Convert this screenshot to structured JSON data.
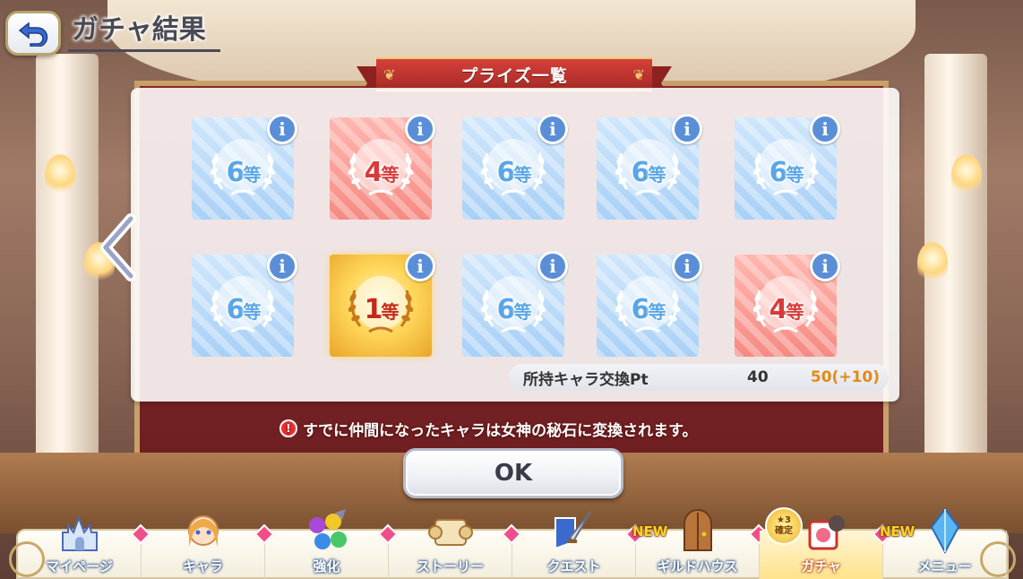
{
  "header": {
    "title": "ガチャ結果"
  },
  "banner": {
    "title": "プライズ一覧"
  },
  "prizes": [
    {
      "rank": "6",
      "unit": "等",
      "color": "blue"
    },
    {
      "rank": "4",
      "unit": "等",
      "color": "red"
    },
    {
      "rank": "6",
      "unit": "等",
      "color": "blue"
    },
    {
      "rank": "6",
      "unit": "等",
      "color": "blue"
    },
    {
      "rank": "6",
      "unit": "等",
      "color": "blue"
    },
    {
      "rank": "6",
      "unit": "等",
      "color": "blue"
    },
    {
      "rank": "1",
      "unit": "等",
      "color": "gold"
    },
    {
      "rank": "6",
      "unit": "等",
      "color": "blue"
    },
    {
      "rank": "6",
      "unit": "等",
      "color": "blue"
    },
    {
      "rank": "4",
      "unit": "等",
      "color": "red"
    }
  ],
  "info_glyph": "i",
  "points": {
    "label": "所持キャラ交換Pt",
    "current": "40",
    "after": "50(+10)"
  },
  "notice": {
    "icon": "!",
    "text": "すでに仲間になったキャラは女神の秘石に変換されます。"
  },
  "ok_button": "OK",
  "nav": {
    "items": [
      {
        "label": "マイページ",
        "icon": "castle-icon",
        "new": ""
      },
      {
        "label": "キャラ",
        "icon": "character-icon",
        "new": ""
      },
      {
        "label": "強化",
        "icon": "gems-icon",
        "new": ""
      },
      {
        "label": "ストーリー",
        "icon": "scroll-icon",
        "new": ""
      },
      {
        "label": "クエスト",
        "icon": "sword-shield-icon",
        "new": ""
      },
      {
        "label": "ギルドハウス",
        "icon": "door-icon",
        "new": "NEW"
      },
      {
        "label": "ガチャ",
        "icon": "gacha-icon",
        "new": ""
      },
      {
        "label": "メニュー",
        "icon": "crystal-icon",
        "new": "NEW"
      }
    ],
    "gacha_badge_top": "★3",
    "gacha_badge_bottom": "確定"
  },
  "colors": {
    "blue_tile": "#a8d0f6",
    "red_tile": "#f58a82",
    "gold_tile": "#ffd65a",
    "accent_orange": "#e28a14",
    "banner_red": "#c8342e"
  }
}
